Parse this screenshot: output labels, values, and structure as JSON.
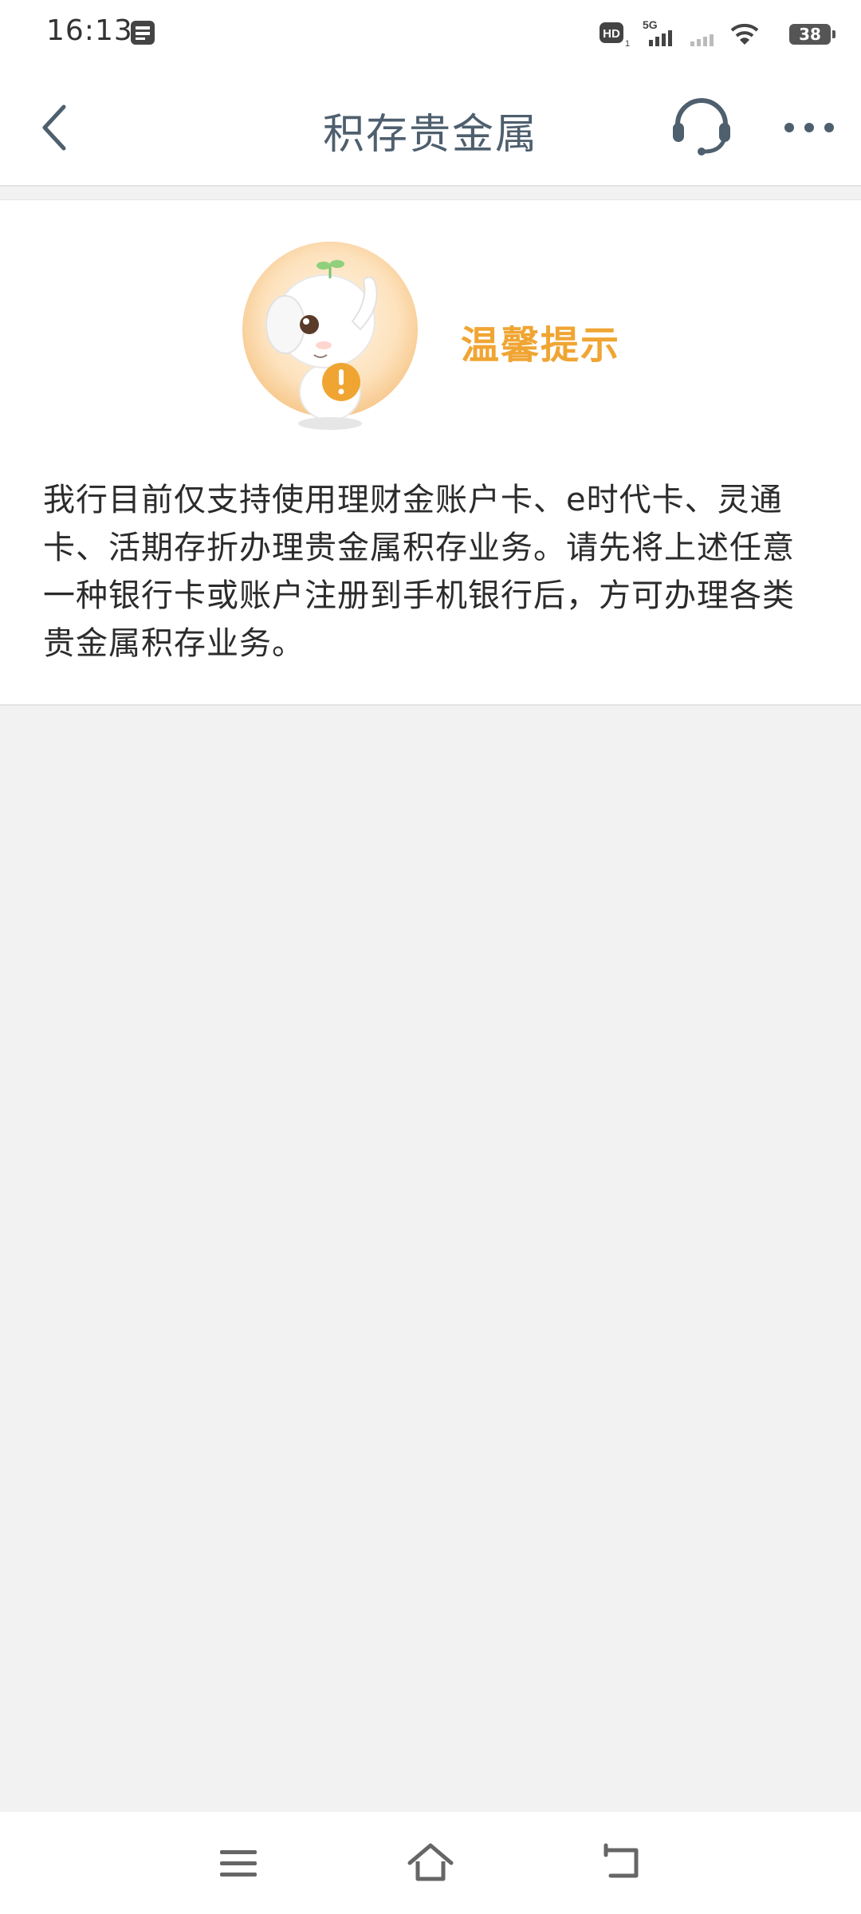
{
  "status_bar": {
    "time": "16:13",
    "battery": "38",
    "icons": [
      "message-icon",
      "hd-icon",
      "5g-signal-icon",
      "signal-icon",
      "wifi-icon",
      "battery-icon"
    ]
  },
  "header": {
    "title": "积存贵金属",
    "icons": {
      "back": "chevron-left-icon",
      "service": "headset-icon",
      "more": "more-dots-icon"
    }
  },
  "notice": {
    "title": "温馨提示",
    "text": "我行目前仅支持使用理财金账户卡、e时代卡、灵通卡、活期存折办理贵金属积存业务。请先将上述任意一种银行卡或账户注册到手机银行后，方可办理各类贵金属积存业务。"
  },
  "nav_bar": {
    "icons": [
      "menu-icon",
      "home-icon",
      "back-arrow-icon"
    ]
  },
  "colors": {
    "accent": "#f0a533",
    "title": "#4e5f6e",
    "background": "#f2f2f2"
  }
}
